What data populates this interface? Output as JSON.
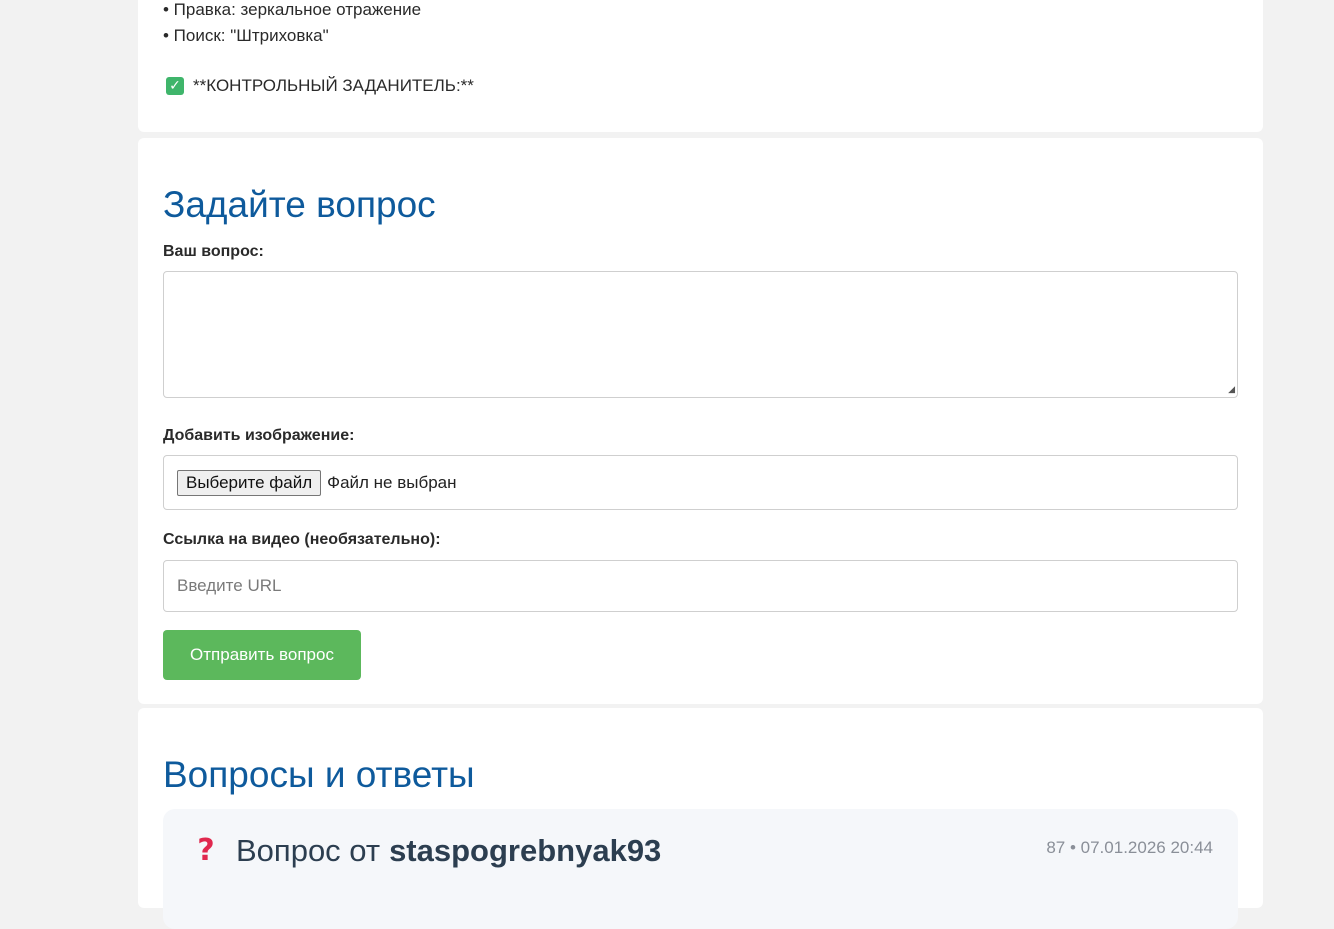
{
  "info_card": {
    "lines": [
      "• Правка: зеркальное отражение",
      "• Поиск: \"Штриховка\""
    ],
    "check_icon": "✓",
    "check_text": "**КОНТРОЛЬНЫЙ ЗАДАНИТЕЛЬ:**"
  },
  "ask_form": {
    "title": "Задайте вопрос",
    "question_label": "Ваш вопрос:",
    "question_value": "",
    "image_label": "Добавить изображение:",
    "file_button_label": "Выберите файл",
    "file_status": "Файл не выбран",
    "video_label": "Ссылка на видео (необязательно):",
    "video_placeholder": "Введите URL",
    "submit_label": "Отправить вопрос"
  },
  "qa": {
    "title": "Вопросы и ответы",
    "questions": [
      {
        "icon": "question-mark-icon",
        "icon_glyph": "?",
        "prefix": "Вопрос от",
        "author": "staspogrebnyak93",
        "meta": "87 • 07.01.2026 20:44"
      }
    ]
  },
  "colors": {
    "page_background": "#f2f2f2",
    "card_background": "#ffffff",
    "heading_blue": "#0e5a9c",
    "submit_green": "#5cb85c",
    "check_green": "#3fb56b",
    "question_icon_red": "#e0284e"
  }
}
